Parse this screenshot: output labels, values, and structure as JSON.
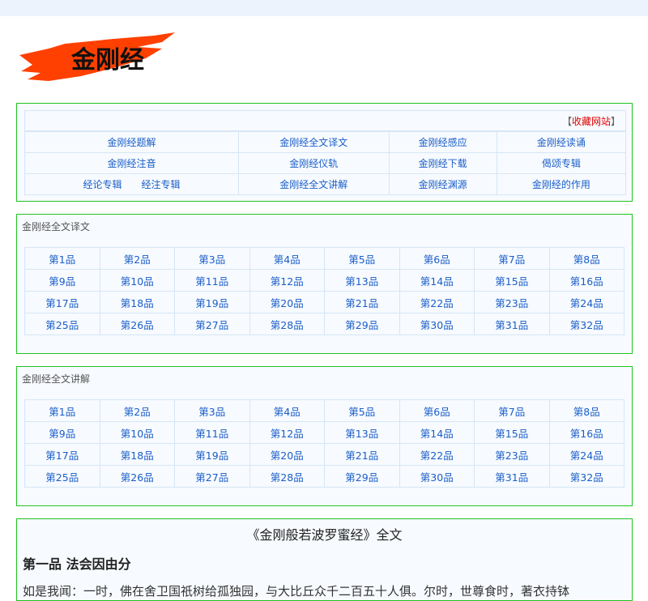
{
  "logo": {
    "text": "金刚经",
    "color": "#ff4000"
  },
  "nav": {
    "favorite": {
      "open": "【",
      "label": "收藏网站",
      "close": "】"
    },
    "rows": [
      [
        "金刚经题解",
        "金刚经全文译文",
        "金刚经感应",
        "金刚经读诵"
      ],
      [
        "金刚经注音",
        "金刚经仪轨",
        "金刚经下载",
        "偈颂专辑"
      ],
      [
        [
          "经论专辑",
          "经注专辑"
        ],
        "金刚经全文讲解",
        "金刚经渊源",
        "金刚经的作用"
      ]
    ]
  },
  "translation": {
    "title": "金刚经全文译文",
    "items": [
      "第1品",
      "第2品",
      "第3品",
      "第4品",
      "第5品",
      "第6品",
      "第7品",
      "第8品",
      "第9品",
      "第10品",
      "第11品",
      "第12品",
      "第13品",
      "第14品",
      "第15品",
      "第16品",
      "第17品",
      "第18品",
      "第19品",
      "第20品",
      "第21品",
      "第22品",
      "第23品",
      "第24品",
      "第25品",
      "第26品",
      "第27品",
      "第28品",
      "第29品",
      "第30品",
      "第31品",
      "第32品"
    ]
  },
  "lecture": {
    "title": "金刚经全文讲解",
    "items": [
      "第1品",
      "第2品",
      "第3品",
      "第4品",
      "第5品",
      "第6品",
      "第7品",
      "第8品",
      "第9品",
      "第10品",
      "第11品",
      "第12品",
      "第13品",
      "第14品",
      "第15品",
      "第16品",
      "第17品",
      "第18品",
      "第19品",
      "第20品",
      "第21品",
      "第22品",
      "第23品",
      "第24品",
      "第25品",
      "第26品",
      "第27品",
      "第28品",
      "第29品",
      "第30品",
      "第31品",
      "第32品"
    ]
  },
  "fulltext": {
    "title": "《金刚般若波罗蜜经》全文",
    "chapter": "第一品  法会因由分",
    "paragraph": "如是我闻：一时，佛在舍卫国祇树给孤独园，与大比丘众千二百五十人俱。尔时，世尊食时，著衣持钵"
  },
  "colors": {
    "border": "#22c322",
    "link": "#1a5ec8",
    "favorite": "#e00000",
    "background": "#f7fafe"
  }
}
